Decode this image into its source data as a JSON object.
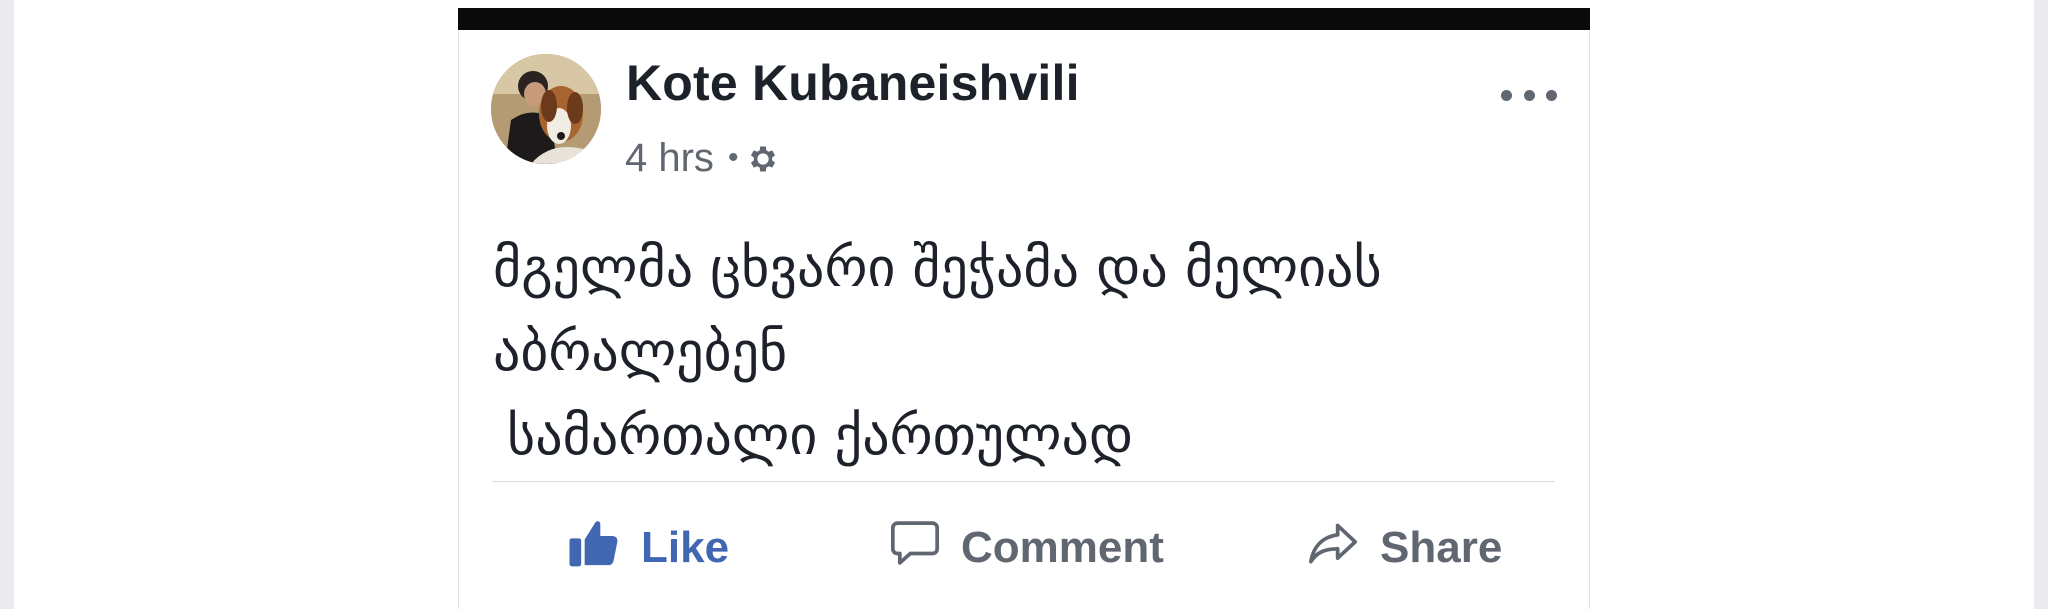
{
  "post": {
    "author": "Kote Kubaneishvili",
    "time": "4 hrs",
    "separator": "•",
    "privacy_icon": "gear-icon",
    "more_icon": "more-dots-icon",
    "text_lines": [
      "მგელმა ცხვარი შეჭამა და მელიას",
      "აბრალებენ",
      "სამართალი ქართულად"
    ]
  },
  "actions": {
    "like": {
      "label": "Like",
      "icon": "thumbs-up-icon"
    },
    "comment": {
      "label": "Comment",
      "icon": "comment-bubble-icon"
    },
    "share": {
      "label": "Share",
      "icon": "share-arrow-icon"
    }
  },
  "colors": {
    "like_blue": "#4267b2",
    "text": "#1d2129",
    "meta_gray": "#616770",
    "divider": "#dadde1"
  }
}
